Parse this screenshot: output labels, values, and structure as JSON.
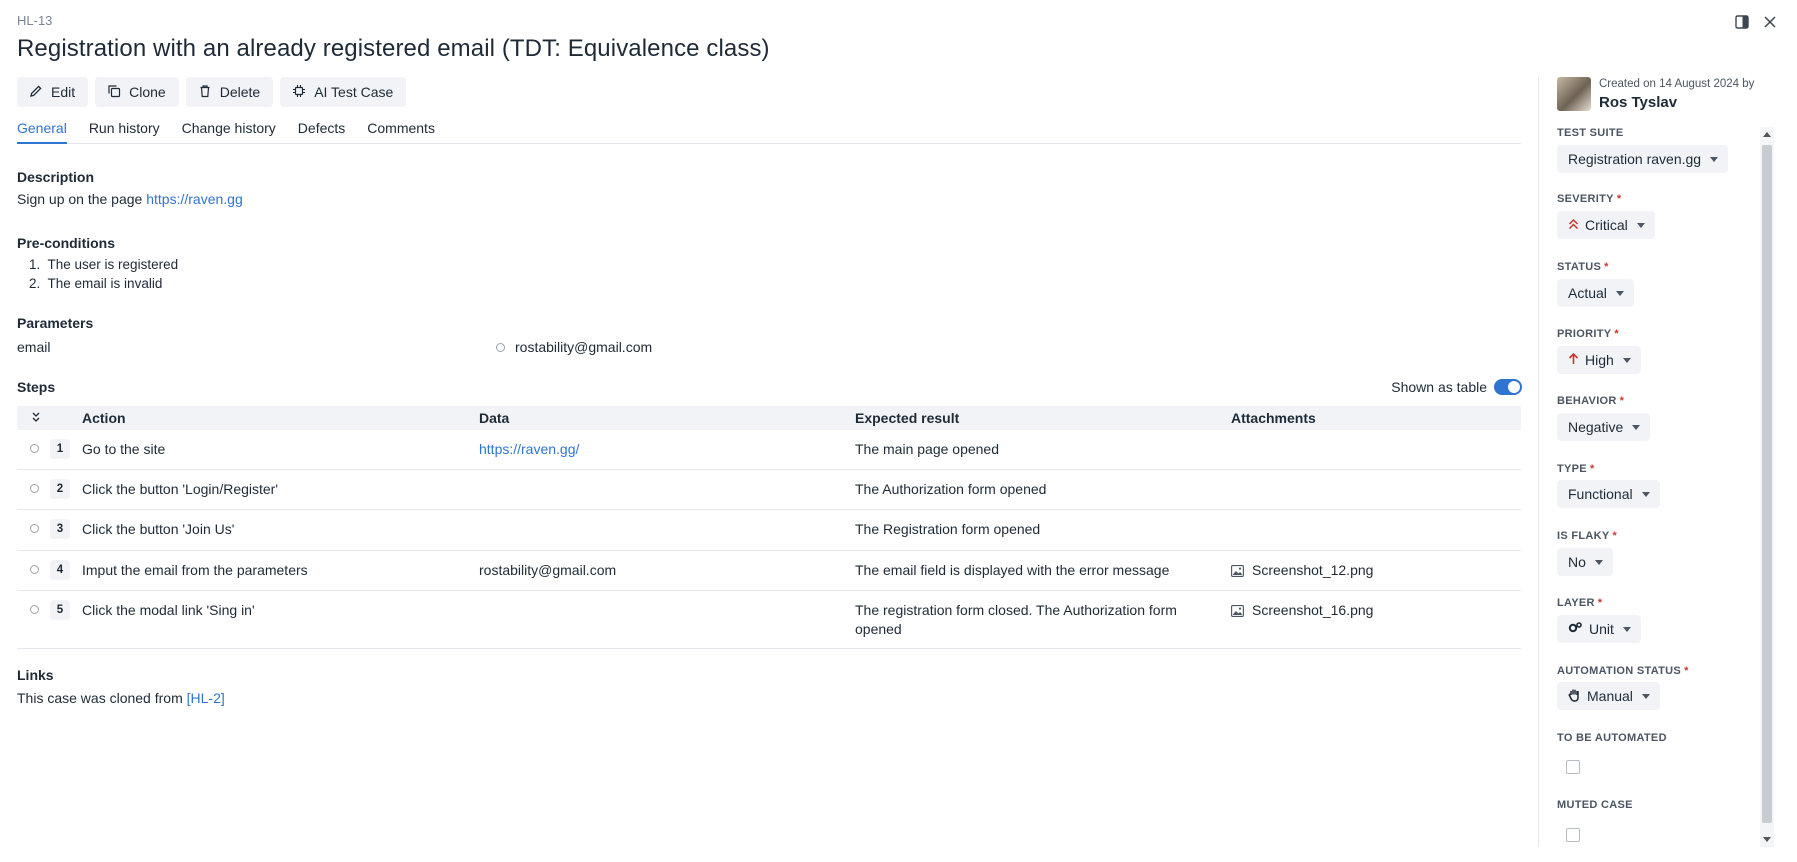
{
  "header": {
    "case_id": "HL-13",
    "title": "Registration with an already registered email (TDT: Equivalence class)"
  },
  "toolbar": {
    "edit_label": "Edit",
    "clone_label": "Clone",
    "delete_label": "Delete",
    "ai_label": "AI Test Case"
  },
  "tabs": [
    {
      "label": "General",
      "active": true
    },
    {
      "label": "Run history",
      "active": false
    },
    {
      "label": "Change history",
      "active": false
    },
    {
      "label": "Defects",
      "active": false
    },
    {
      "label": "Comments",
      "active": false
    }
  ],
  "description": {
    "label": "Description",
    "text": "Sign up on the page ",
    "link": "https://raven.gg"
  },
  "preconditions": {
    "label": "Pre-conditions",
    "items": [
      "The user is registered",
      "The email is invalid"
    ]
  },
  "parameters": {
    "label": "Parameters",
    "name": "email",
    "value": "rostability@gmail.com"
  },
  "steps": {
    "label": "Steps",
    "shown_as_table_label": "Shown as table",
    "shown_as_table": true,
    "columns": [
      "Action",
      "Data",
      "Expected result",
      "Attachments"
    ],
    "rows": [
      {
        "num": "1",
        "action": "Go to the site",
        "data": "https://raven.gg/",
        "expected": "The main page opened",
        "attachment": ""
      },
      {
        "num": "2",
        "action": "Click the button 'Login/Register'",
        "data": "",
        "expected": "The Authorization form opened",
        "attachment": ""
      },
      {
        "num": "3",
        "action": "Click the button 'Join Us'",
        "data": "",
        "expected": "The Registration form opened",
        "attachment": ""
      },
      {
        "num": "4",
        "action": "Imput the email from the parameters",
        "data": "rostability@gmail.com",
        "expected": "The email field is displayed with the error message",
        "attachment": "Screenshot_12.png"
      },
      {
        "num": "5",
        "action": "Click the modal link 'Sing in'",
        "data": "",
        "expected": "The registration form closed. The Authorization form opened",
        "attachment": "Screenshot_16.png"
      }
    ]
  },
  "links": {
    "label": "Links",
    "text": "This case was cloned from ",
    "link": "[HL-2]"
  },
  "sidebar": {
    "created": "Created on 14 August 2024 by",
    "creator": "Ros Tyslav",
    "fields": {
      "test_suite": {
        "label": "TEST SUITE",
        "value": "Registration raven.gg"
      },
      "severity": {
        "label": "SEVERITY",
        "value": "Critical"
      },
      "status": {
        "label": "STATUS",
        "value": "Actual"
      },
      "priority": {
        "label": "PRIORITY",
        "value": "High"
      },
      "behavior": {
        "label": "BEHAVIOR",
        "value": "Negative"
      },
      "type": {
        "label": "TYPE",
        "value": "Functional"
      },
      "is_flaky": {
        "label": "IS FLAKY",
        "value": "No"
      },
      "layer": {
        "label": "LAYER",
        "value": "Unit"
      },
      "automation_status": {
        "label": "AUTOMATION STATUS",
        "value": "Manual"
      },
      "to_be_automated": {
        "label": "TO BE AUTOMATED",
        "checked": false
      },
      "muted_case": {
        "label": "MUTED CASE",
        "checked": false
      }
    },
    "required_mark": "*"
  },
  "colors": {
    "accent": "#2f74d0",
    "critical": "#d0342c",
    "high": "#d0342c"
  }
}
